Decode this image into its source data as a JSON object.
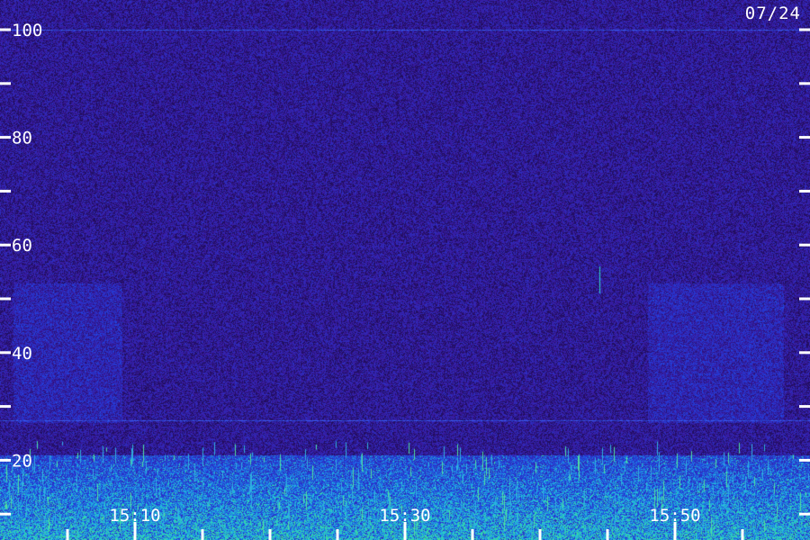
{
  "chart_data": {
    "type": "heatmap",
    "title": "",
    "date": "07/24",
    "xlabel": "",
    "ylabel": "",
    "y_range": [
      10,
      103
    ],
    "y_ticks": [
      100,
      80,
      60,
      40,
      20
    ],
    "y_minor_ticks": [
      90,
      70,
      50,
      30,
      10
    ],
    "x_range_minutes": [
      0,
      60
    ],
    "x_tick_labels": [
      {
        "minute": 10,
        "label": "15:10"
      },
      {
        "minute": 30,
        "label": "15:30"
      },
      {
        "minute": 50,
        "label": "15:50"
      }
    ],
    "x_minor_tick_minutes": [
      5,
      15,
      20,
      25,
      35,
      40,
      45,
      55
    ],
    "colormap": [
      "#1a0a4a",
      "#3a1aa0",
      "#2040e0",
      "#20c0e0",
      "#40e090"
    ],
    "features": [
      {
        "type": "strong band",
        "y_from": 10,
        "y_to": 20
      },
      {
        "type": "horizontal line",
        "y": 100
      },
      {
        "type": "horizontal line",
        "y": 27.5
      },
      {
        "type": "diffuse emission",
        "minute_from": 1,
        "minute_to": 9,
        "y_from": 27,
        "y_to": 53
      },
      {
        "type": "diffuse emission",
        "minute_from": 48,
        "minute_to": 58,
        "y_from": 27,
        "y_to": 53
      },
      {
        "type": "spike",
        "minute": 44.4,
        "y_from": 51,
        "y_to": 56
      }
    ]
  },
  "colors": {
    "background": "#241268",
    "tick": "#ffffff",
    "label": "#ffffff"
  }
}
